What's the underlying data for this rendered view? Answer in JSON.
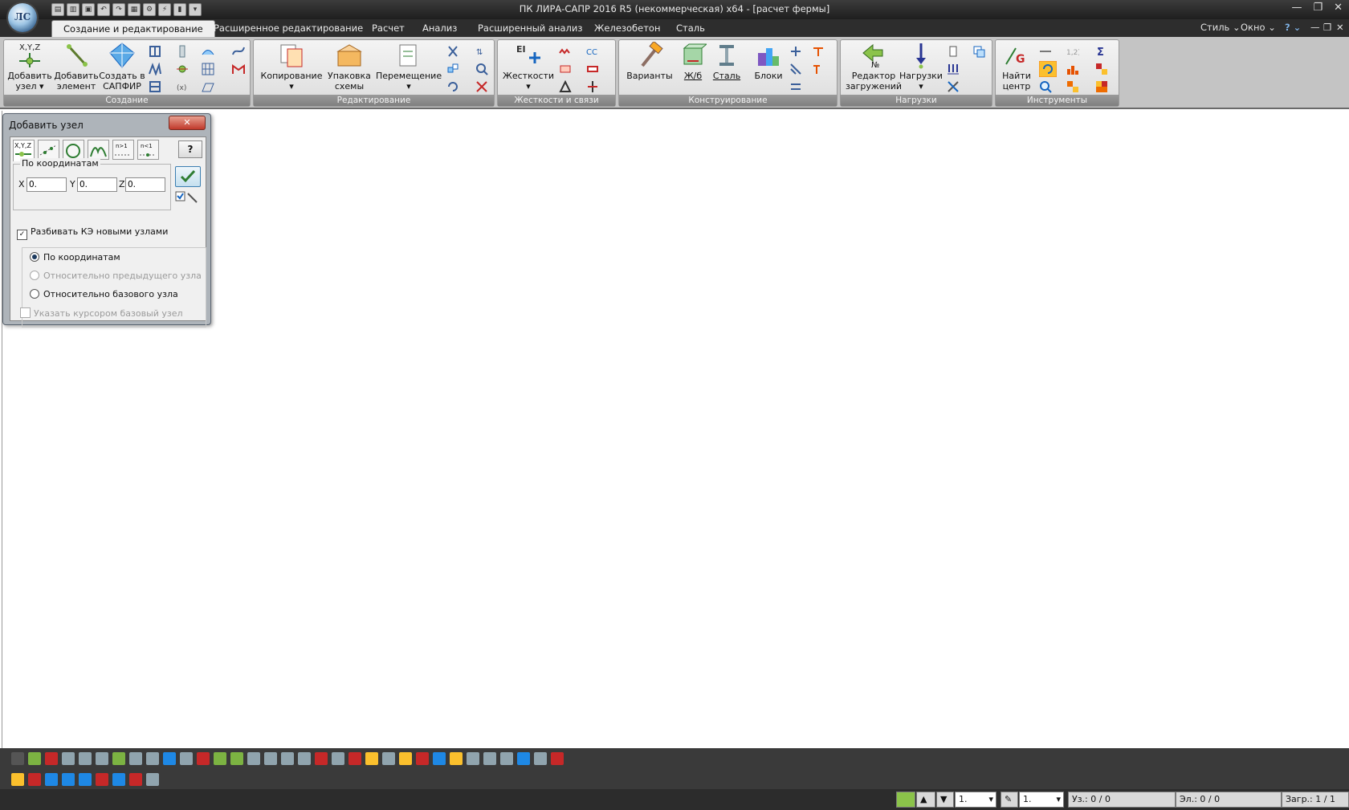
{
  "window": {
    "title": "ПК ЛИРА-САПР  2016 R5 (некоммерческая) x64 - [расчет фермы]",
    "logo_text": "ЛС",
    "controls": [
      "—",
      "❐",
      "✕"
    ]
  },
  "tabs": [
    {
      "label": "Создание и редактирование",
      "active": true
    },
    {
      "label": "Расширенное редактирование"
    },
    {
      "label": "Расчет"
    },
    {
      "label": "Анализ"
    },
    {
      "label": "Расширенный анализ"
    },
    {
      "label": "Железобетон"
    },
    {
      "label": "Сталь"
    }
  ],
  "tab_right": {
    "style": "Стиль",
    "window": "Окно",
    "help": "?"
  },
  "ribbon": {
    "groups": [
      {
        "label": "Создание"
      },
      {
        "label": "Редактирование"
      },
      {
        "label": "Жесткости и связи"
      },
      {
        "label": "Конструирование"
      },
      {
        "label": "Нагрузки"
      },
      {
        "label": "Инструменты"
      }
    ],
    "buttons": {
      "add_node_l1": "Добавить",
      "add_node_l2": "узел",
      "add_element_l1": "Добавить",
      "add_element_l2": "элемент",
      "create_sapfir_l1": "Создать в",
      "create_sapfir_l2": "САПФИР",
      "copy": "Копирование",
      "pack_l1": "Упаковка",
      "pack_l2": "схемы",
      "move": "Перемещение",
      "stiffness": "Жесткости",
      "variants": "Варианты",
      "rc": "Ж/б",
      "steel": "Сталь",
      "blocks": "Блоки",
      "load_editor_l1": "Редактор",
      "load_editor_l2": "загружений",
      "loads": "Нагрузки",
      "find_center_l1": "Найти",
      "find_center_l2": "центр",
      "xyz_icon_text": "X,Y,Z",
      "ei_icon_text": "EI"
    }
  },
  "dialog": {
    "title": "Добавить узел",
    "close": "✕",
    "help": "?",
    "tab_xyz_text": "X,Y,Z",
    "frame_label": "По координатам",
    "x_label": "X",
    "x_value": "0.",
    "y_label": "Y",
    "y_value": "0.",
    "z_label": "Z",
    "z_value": "0.",
    "split_fe": "Разбивать КЭ новыми узлами",
    "radio_coords": "По координатам",
    "radio_prev": "Относительно предыдущего узла",
    "radio_base": "Относительно базового узла",
    "cursor_base": "Указать курсором базовый узел"
  },
  "status": {
    "combo1": "1.",
    "combo2": "1.",
    "nodes": "Уз.: 0 / 0",
    "elements": "Эл.: 0 / 0",
    "loadcases": "Загр.: 1 / 1"
  }
}
